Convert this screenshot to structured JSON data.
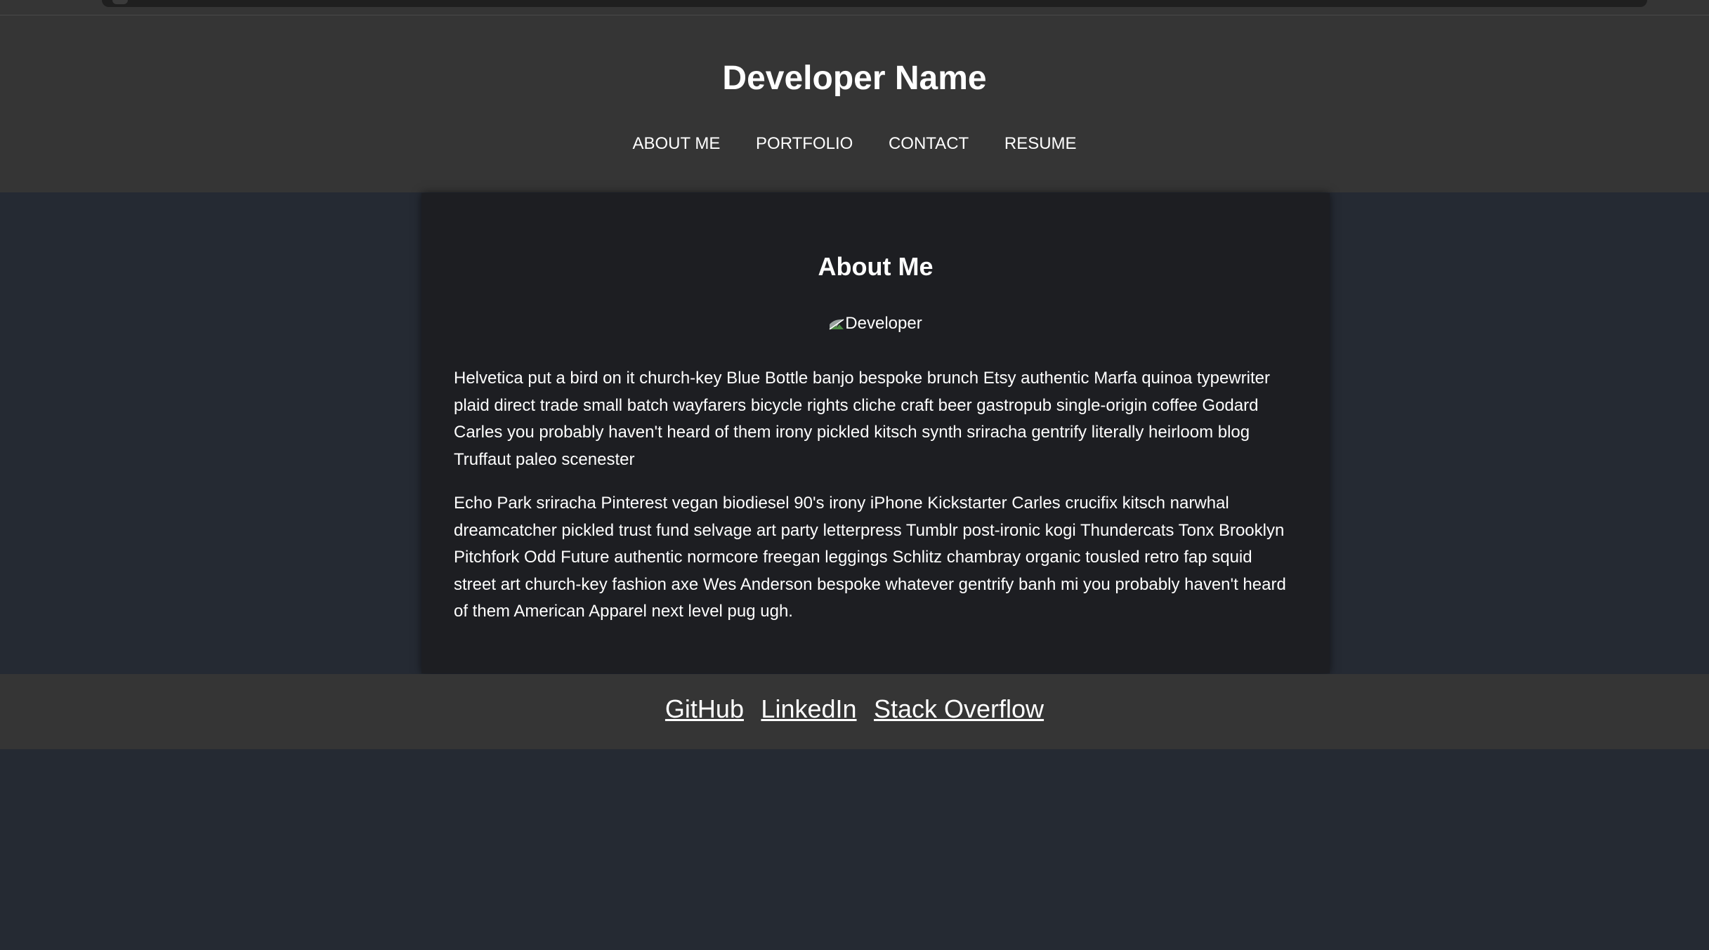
{
  "header": {
    "site_title": "Developer Name",
    "nav": [
      "ABOUT ME",
      "PORTFOLIO",
      "CONTACT",
      "RESUME"
    ]
  },
  "about": {
    "title": "About Me",
    "image_alt": "Developer",
    "paragraphs": [
      "Helvetica put a bird on it church-key Blue Bottle banjo bespoke brunch Etsy authentic Marfa quinoa typewriter plaid direct trade small batch wayfarers bicycle rights cliche craft beer gastropub single-origin coffee Godard Carles you probably haven't heard of them irony pickled kitsch synth sriracha gentrify literally heirloom blog Truffaut paleo scenester",
      "Echo Park sriracha Pinterest vegan biodiesel 90's irony iPhone Kickstarter Carles crucifix kitsch narwhal dreamcatcher pickled trust fund selvage art party letterpress Tumblr post-ironic kogi Thundercats Tonx Brooklyn Pitchfork Odd Future authentic normcore freegan leggings Schlitz chambray organic tousled retro fap squid street art church-key fashion axe Wes Anderson bespoke whatever gentrify banh mi you probably haven't heard of them American Apparel next level pug ugh."
    ]
  },
  "footer": {
    "links": [
      "GitHub",
      "LinkedIn",
      "Stack Overflow"
    ]
  },
  "colors": {
    "page_bg": "#252a33",
    "header_bg": "#353535",
    "card_bg": "#1d1e22",
    "text": "#ffffff"
  }
}
